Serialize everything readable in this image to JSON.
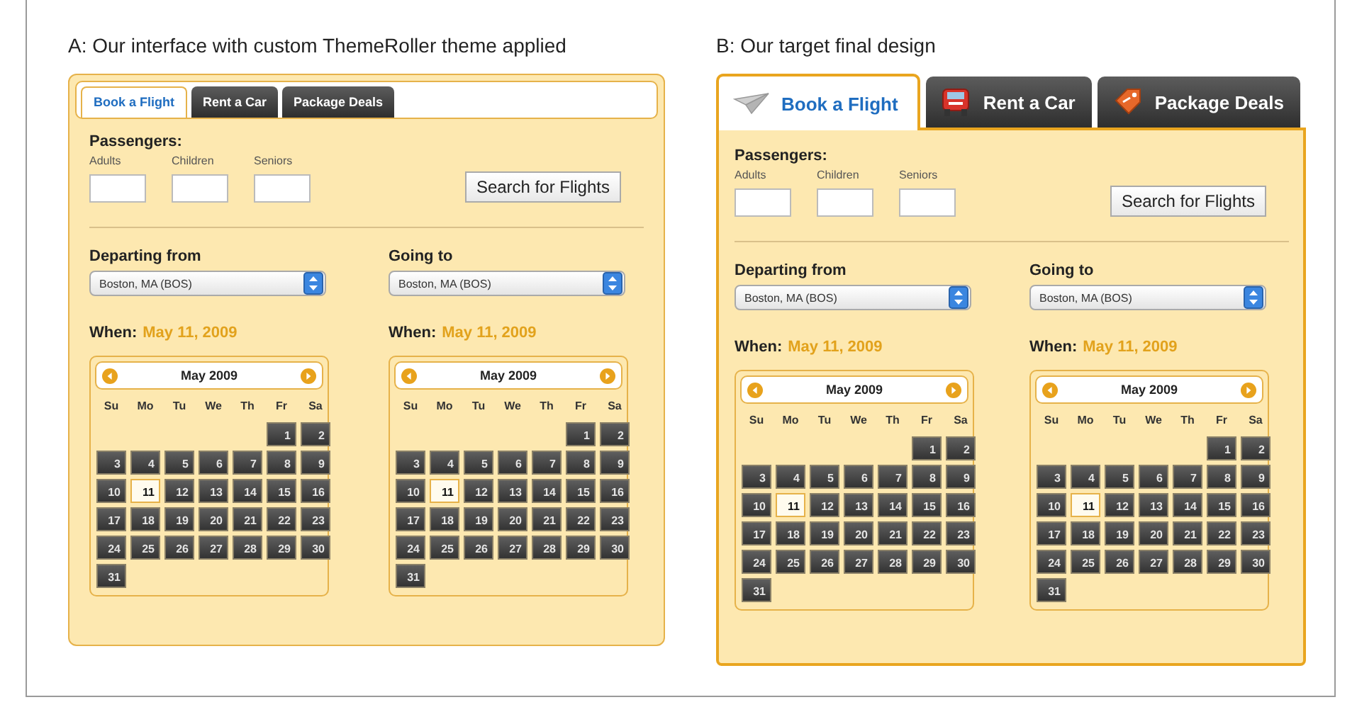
{
  "figure_panels": [
    {
      "caption": "A: Our interface with custom ThemeRoller theme applied",
      "kind": "plain",
      "tabs": [
        {
          "label": "Book a Flight",
          "selected": true
        },
        {
          "label": "Rent a Car",
          "selected": false
        },
        {
          "label": "Package Deals",
          "selected": false
        }
      ],
      "passengers": {
        "label": "Passengers:",
        "fields": [
          "Adults",
          "Children",
          "Seniors"
        ]
      },
      "search_button": "Search for Flights",
      "routes": [
        {
          "label": "Departing from",
          "value": "Boston, MA (BOS)",
          "when_label": "When:",
          "when_value": "May 11, 2009",
          "calendar": {
            "title": "May 2009",
            "weekdays": [
              "Su",
              "Mo",
              "Tu",
              "We",
              "Th",
              "Fr",
              "Sa"
            ],
            "weeks": [
              [
                {
                  "day": "1",
                  "selected": false
                },
                {
                  "day": "2",
                  "selected": false
                }
              ],
              [
                {
                  "day": "3",
                  "selected": false
                },
                {
                  "day": "4",
                  "selected": false
                },
                {
                  "day": "5",
                  "selected": false
                },
                {
                  "day": "6",
                  "selected": false
                },
                {
                  "day": "7",
                  "selected": false
                },
                {
                  "day": "8",
                  "selected": false
                },
                {
                  "day": "9",
                  "selected": false
                }
              ],
              [
                {
                  "day": "10",
                  "selected": false
                },
                {
                  "day": "11",
                  "selected": true
                },
                {
                  "day": "12",
                  "selected": false
                },
                {
                  "day": "13",
                  "selected": false
                },
                {
                  "day": "14",
                  "selected": false
                },
                {
                  "day": "15",
                  "selected": false
                },
                {
                  "day": "16",
                  "selected": false
                }
              ],
              [
                {
                  "day": "17",
                  "selected": false
                },
                {
                  "day": "18",
                  "selected": false
                },
                {
                  "day": "19",
                  "selected": false
                },
                {
                  "day": "20",
                  "selected": false
                },
                {
                  "day": "21",
                  "selected": false
                },
                {
                  "day": "22",
                  "selected": false
                },
                {
                  "day": "23",
                  "selected": false
                }
              ],
              [
                {
                  "day": "24",
                  "selected": false
                },
                {
                  "day": "25",
                  "selected": false
                },
                {
                  "day": "26",
                  "selected": false
                },
                {
                  "day": "27",
                  "selected": false
                },
                {
                  "day": "28",
                  "selected": false
                },
                {
                  "day": "29",
                  "selected": false
                },
                {
                  "day": "30",
                  "selected": false
                }
              ],
              [
                {
                  "day": "31",
                  "selected": false
                }
              ]
            ]
          }
        },
        {
          "label": "Going to",
          "value": "Boston, MA (BOS)",
          "when_label": "When:",
          "when_value": "May 11, 2009",
          "calendar": {
            "title": "May 2009",
            "weekdays": [
              "Su",
              "Mo",
              "Tu",
              "We",
              "Th",
              "Fr",
              "Sa"
            ],
            "weeks": [
              [
                {
                  "day": "1",
                  "selected": false
                },
                {
                  "day": "2",
                  "selected": false
                }
              ],
              [
                {
                  "day": "3",
                  "selected": false
                },
                {
                  "day": "4",
                  "selected": false
                },
                {
                  "day": "5",
                  "selected": false
                },
                {
                  "day": "6",
                  "selected": false
                },
                {
                  "day": "7",
                  "selected": false
                },
                {
                  "day": "8",
                  "selected": false
                },
                {
                  "day": "9",
                  "selected": false
                }
              ],
              [
                {
                  "day": "10",
                  "selected": false
                },
                {
                  "day": "11",
                  "selected": true
                },
                {
                  "day": "12",
                  "selected": false
                },
                {
                  "day": "13",
                  "selected": false
                },
                {
                  "day": "14",
                  "selected": false
                },
                {
                  "day": "15",
                  "selected": false
                },
                {
                  "day": "16",
                  "selected": false
                }
              ],
              [
                {
                  "day": "17",
                  "selected": false
                },
                {
                  "day": "18",
                  "selected": false
                },
                {
                  "day": "19",
                  "selected": false
                },
                {
                  "day": "20",
                  "selected": false
                },
                {
                  "day": "21",
                  "selected": false
                },
                {
                  "day": "22",
                  "selected": false
                },
                {
                  "day": "23",
                  "selected": false
                }
              ],
              [
                {
                  "day": "24",
                  "selected": false
                },
                {
                  "day": "25",
                  "selected": false
                },
                {
                  "day": "26",
                  "selected": false
                },
                {
                  "day": "27",
                  "selected": false
                },
                {
                  "day": "28",
                  "selected": false
                },
                {
                  "day": "29",
                  "selected": false
                },
                {
                  "day": "30",
                  "selected": false
                }
              ],
              [
                {
                  "day": "31",
                  "selected": false
                }
              ]
            ]
          }
        }
      ]
    },
    {
      "caption": "B: Our target final design",
      "kind": "iconic",
      "tabs": [
        {
          "label": "Book a Flight",
          "selected": true
        },
        {
          "label": "Rent a Car",
          "selected": false
        },
        {
          "label": "Package Deals",
          "selected": false
        }
      ],
      "passengers": {
        "label": "Passengers:",
        "fields": [
          "Adults",
          "Children",
          "Seniors"
        ]
      },
      "search_button": "Search for Flights",
      "routes": [
        {
          "label": "Departing from",
          "value": "Boston, MA (BOS)",
          "when_label": "When:",
          "when_value": "May 11, 2009",
          "calendar": {
            "title": "May 2009",
            "weekdays": [
              "Su",
              "Mo",
              "Tu",
              "We",
              "Th",
              "Fr",
              "Sa"
            ],
            "weeks": [
              [
                {
                  "day": "1",
                  "selected": false
                },
                {
                  "day": "2",
                  "selected": false
                }
              ],
              [
                {
                  "day": "3",
                  "selected": false
                },
                {
                  "day": "4",
                  "selected": false
                },
                {
                  "day": "5",
                  "selected": false
                },
                {
                  "day": "6",
                  "selected": false
                },
                {
                  "day": "7",
                  "selected": false
                },
                {
                  "day": "8",
                  "selected": false
                },
                {
                  "day": "9",
                  "selected": false
                }
              ],
              [
                {
                  "day": "10",
                  "selected": false
                },
                {
                  "day": "11",
                  "selected": true
                },
                {
                  "day": "12",
                  "selected": false
                },
                {
                  "day": "13",
                  "selected": false
                },
                {
                  "day": "14",
                  "selected": false
                },
                {
                  "day": "15",
                  "selected": false
                },
                {
                  "day": "16",
                  "selected": false
                }
              ],
              [
                {
                  "day": "17",
                  "selected": false
                },
                {
                  "day": "18",
                  "selected": false
                },
                {
                  "day": "19",
                  "selected": false
                },
                {
                  "day": "20",
                  "selected": false
                },
                {
                  "day": "21",
                  "selected": false
                },
                {
                  "day": "22",
                  "selected": false
                },
                {
                  "day": "23",
                  "selected": false
                }
              ],
              [
                {
                  "day": "24",
                  "selected": false
                },
                {
                  "day": "25",
                  "selected": false
                },
                {
                  "day": "26",
                  "selected": false
                },
                {
                  "day": "27",
                  "selected": false
                },
                {
                  "day": "28",
                  "selected": false
                },
                {
                  "day": "29",
                  "selected": false
                },
                {
                  "day": "30",
                  "selected": false
                }
              ],
              [
                {
                  "day": "31",
                  "selected": false
                }
              ]
            ]
          }
        },
        {
          "label": "Going to",
          "value": "Boston, MA (BOS)",
          "when_label": "When:",
          "when_value": "May 11, 2009",
          "calendar": {
            "title": "May 2009",
            "weekdays": [
              "Su",
              "Mo",
              "Tu",
              "We",
              "Th",
              "Fr",
              "Sa"
            ],
            "weeks": [
              [
                {
                  "day": "1",
                  "selected": false
                },
                {
                  "day": "2",
                  "selected": false
                }
              ],
              [
                {
                  "day": "3",
                  "selected": false
                },
                {
                  "day": "4",
                  "selected": false
                },
                {
                  "day": "5",
                  "selected": false
                },
                {
                  "day": "6",
                  "selected": false
                },
                {
                  "day": "7",
                  "selected": false
                },
                {
                  "day": "8",
                  "selected": false
                },
                {
                  "day": "9",
                  "selected": false
                }
              ],
              [
                {
                  "day": "10",
                  "selected": false
                },
                {
                  "day": "11",
                  "selected": true
                },
                {
                  "day": "12",
                  "selected": false
                },
                {
                  "day": "13",
                  "selected": false
                },
                {
                  "day": "14",
                  "selected": false
                },
                {
                  "day": "15",
                  "selected": false
                },
                {
                  "day": "16",
                  "selected": false
                }
              ],
              [
                {
                  "day": "17",
                  "selected": false
                },
                {
                  "day": "18",
                  "selected": false
                },
                {
                  "day": "19",
                  "selected": false
                },
                {
                  "day": "20",
                  "selected": false
                },
                {
                  "day": "21",
                  "selected": false
                },
                {
                  "day": "22",
                  "selected": false
                },
                {
                  "day": "23",
                  "selected": false
                }
              ],
              [
                {
                  "day": "24",
                  "selected": false
                },
                {
                  "day": "25",
                  "selected": false
                },
                {
                  "day": "26",
                  "selected": false
                },
                {
                  "day": "27",
                  "selected": false
                },
                {
                  "day": "28",
                  "selected": false
                },
                {
                  "day": "29",
                  "selected": false
                },
                {
                  "day": "30",
                  "selected": false
                }
              ],
              [
                {
                  "day": "31",
                  "selected": false
                }
              ]
            ]
          }
        }
      ]
    }
  ]
}
